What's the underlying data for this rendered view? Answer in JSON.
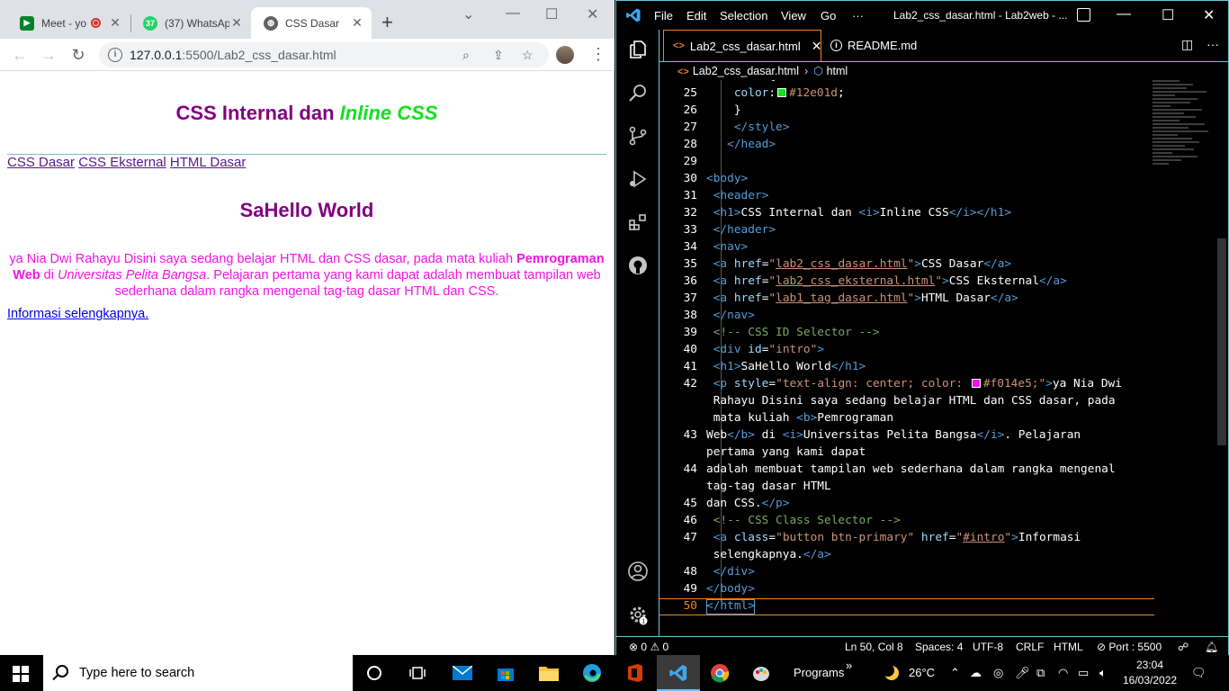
{
  "chrome": {
    "tabs": [
      {
        "title": "Meet - yo",
        "icon": "meet-icon"
      },
      {
        "title": "(37) WhatsAp",
        "icon": "whatsapp-icon",
        "badge": "37"
      },
      {
        "title": "CSS Dasar",
        "icon": "globe-icon"
      }
    ],
    "new_tab": "+",
    "url_host": "127.0.0.1",
    "url_rest": ":5500/Lab2_css_dasar.html"
  },
  "page": {
    "h1_plain": "CSS Internal dan ",
    "h1_italic": "Inline CSS",
    "nav": [
      "CSS Dasar",
      "CSS Eksternal",
      "HTML Dasar"
    ],
    "h1_intro": "SaHello World",
    "para_1": "ya Nia Dwi Rahayu Disini saya sedang belajar HTML dan CSS dasar, pada mata kuliah ",
    "para_bold": "Pemrograman Web",
    "para_2": " di ",
    "para_italic": "Universitas Pelita Bangsa",
    "para_3": ". Pelajaran pertama yang kami dapat adalah membuat tampilan web sederhana dalam rangka mengenal tag-tag dasar HTML dan CSS.",
    "more_link": "Informasi selengkapnya."
  },
  "vscode": {
    "menu": [
      "File",
      "Edit",
      "Selection",
      "View",
      "Go",
      "···"
    ],
    "window_title": "Lab2_css_dasar.html - Lab2web - ...",
    "tabs": [
      {
        "label": "Lab2_css_dasar.html",
        "icon": "html-icon",
        "active": true
      },
      {
        "label": "README.md",
        "icon": "info-icon",
        "active": false
      }
    ],
    "breadcrumb": [
      "Lab2_css_dasar.html",
      "html"
    ],
    "line_numbers": [
      "25",
      "26",
      "27",
      "28",
      "29",
      "30",
      "31",
      "32",
      "33",
      "34",
      "35",
      "36",
      "37",
      "38",
      "39",
      "40",
      "41",
      "42",
      "",
      "",
      "43",
      "",
      "44",
      "",
      "45",
      "46",
      "47",
      "",
      "48",
      "49",
      "50"
    ],
    "current_line": "50",
    "status": {
      "errors": "0",
      "warnings": "0",
      "position": "Ln 50, Col 8",
      "spaces": "Spaces: 4",
      "encoding": "UTF-8",
      "eol": "CRLF",
      "language": "HTML",
      "port": "Port : 5500"
    },
    "colors": {
      "green_swatch": "#12e01d",
      "pink_swatch": "#f014e5",
      "accent": "#f38518",
      "border": "#6fc3df"
    }
  },
  "taskbar": {
    "search_placeholder": "Type here to search",
    "programs": "Programs",
    "chevron": "»",
    "temperature": "26°C",
    "time": "23:04",
    "date": "16/03/2022"
  }
}
